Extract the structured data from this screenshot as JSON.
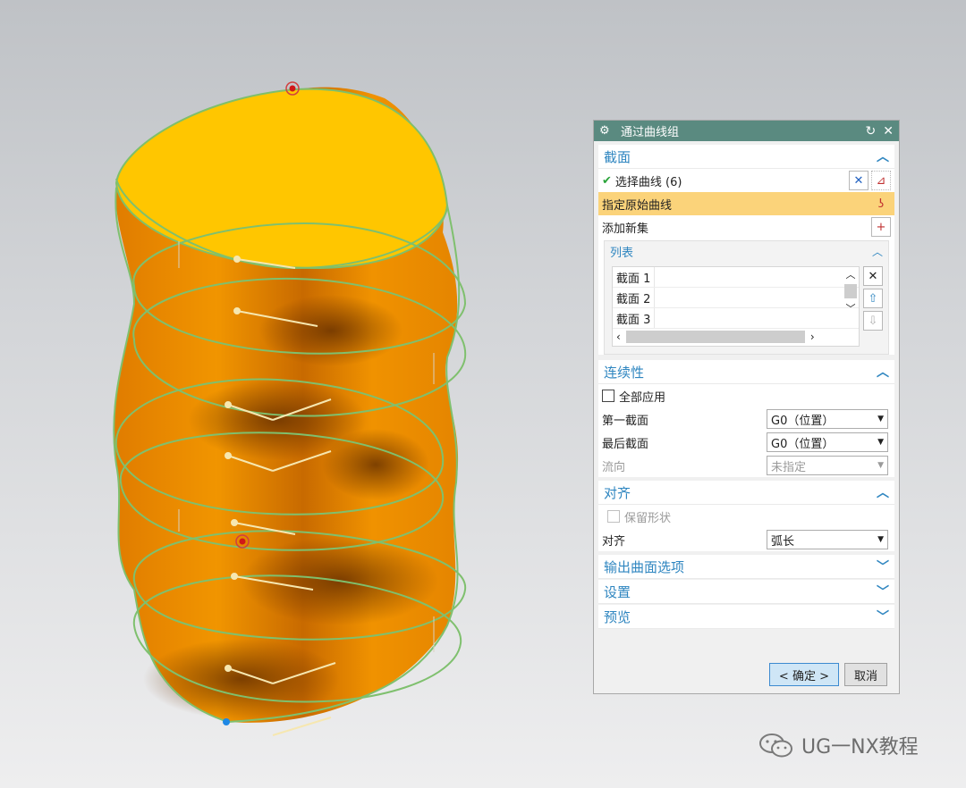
{
  "dialog": {
    "title": "通过曲线组",
    "sections": {
      "section": {
        "title": "截面",
        "select_curve": "选择曲线 (6)",
        "specify_original": "指定原始曲线",
        "add_new_set": "添加新集",
        "list": {
          "title": "列表",
          "items": [
            "截面 1",
            "截面 2",
            "截面 3"
          ]
        }
      },
      "continuity": {
        "title": "连续性",
        "apply_all": "全部应用",
        "first_section_label": "第一截面",
        "first_section_value": "G0（位置）",
        "last_section_label": "最后截面",
        "last_section_value": "G0（位置）",
        "flow_label": "流向",
        "flow_value": "未指定"
      },
      "alignment": {
        "title": "对齐",
        "keep_shape": "保留形状",
        "align_label": "对齐",
        "align_value": "弧长"
      },
      "output_options": {
        "title": "输出曲面选项"
      },
      "settings": {
        "title": "设置"
      },
      "preview": {
        "title": "预览"
      }
    },
    "buttons": {
      "ok": "< 确定 >",
      "cancel": "取消"
    }
  },
  "watermark": {
    "text": "UG一NX教程"
  },
  "colors": {
    "title_bar": "#5a8a80",
    "accent": "#2f86c0",
    "highlight": "#fbd37a",
    "surface_top": "#ffc300",
    "surface_body": "#e88a00"
  }
}
